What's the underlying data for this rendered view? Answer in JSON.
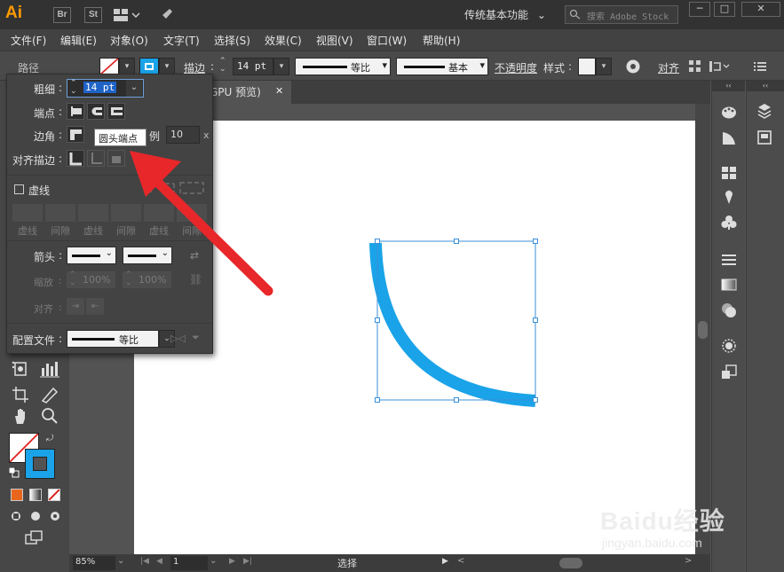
{
  "app": {
    "logo": "Ai",
    "bridge_label": "Br",
    "stock_label": "St",
    "workspace": "传统基本功能",
    "search_placeholder": "搜索 Adobe Stock",
    "minimize": "─",
    "maximize": "□",
    "close": "✕"
  },
  "menu": [
    "文件(F)",
    "编辑(E)",
    "对象(O)",
    "文字(T)",
    "选择(S)",
    "效果(C)",
    "视图(V)",
    "窗口(W)",
    "帮助(H)"
  ],
  "control": {
    "selection_type": "路径",
    "stroke_label": "描边",
    "stroke_value": "14 pt",
    "profile_label": "等比",
    "brush_label": "基本",
    "opacity_label": "不透明度",
    "style_label": "样式",
    "align_label": "对齐"
  },
  "document_tab": {
    "title": "GPU 预览)",
    "close": "✕"
  },
  "stroke_panel": {
    "weight_label": "粗细",
    "weight_value": "14 pt",
    "cap_label": "端点",
    "corner_label": "边角",
    "limit_label": "例",
    "limit_value": "10",
    "limit_unit": "x",
    "align_label": "对齐描边",
    "dashed_label": "虚线",
    "dash_labels": [
      "虚线",
      "间隙",
      "虚线",
      "间隙",
      "虚线",
      "间隙"
    ],
    "arrow_label": "箭头",
    "scale_label": "缩放",
    "scale_value_1": "100%",
    "scale_value_2": "100%",
    "align_arrow_label": "对齐",
    "profile_label": "配置文件",
    "profile_value": "等比"
  },
  "tooltip": "圆头端点",
  "status": {
    "zoom": "85%",
    "page": "1",
    "tool": "选择"
  },
  "watermark": {
    "brand": "Baidu经验",
    "url": "jingyan.baidu.com"
  },
  "colors": {
    "accent_blue": "#1aa3e8",
    "arrow_red": "#e8272a",
    "logo_orange": "#ff9a00"
  }
}
